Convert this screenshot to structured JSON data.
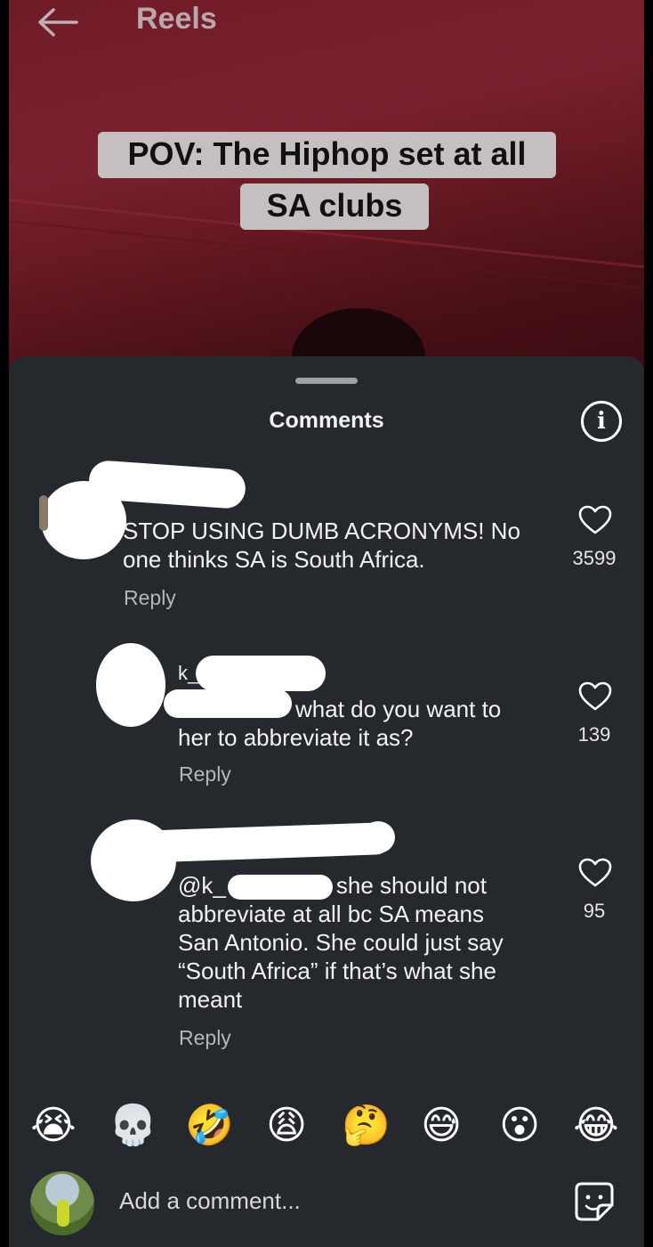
{
  "header": {
    "title": "Reels"
  },
  "video": {
    "caption_line1": "POV: The Hiphop set at all",
    "caption_line2": "SA clubs"
  },
  "sheet": {
    "title": "Comments"
  },
  "comments": [
    {
      "text": "STOP USING DUMB ACRONYMS! No one thinks SA is South Africa.",
      "line1": "STOP USING DUMB ACRONYMS! No",
      "line2": "one thinks SA is South Africa.",
      "likes": "3599",
      "reply_label": "Reply"
    },
    {
      "username_prefix": "k_",
      "line1": "what do you want to",
      "line2": "her to abbreviate it as?",
      "likes": "139",
      "reply_label": "Reply"
    },
    {
      "mention_prefix": "@k_",
      "line1": "she should not",
      "line2": "abbreviate at all bc SA means",
      "line3": "San Antonio. She could just say",
      "line4": "“South Africa” if that’s what she",
      "line5": "meant",
      "likes": "95",
      "reply_label": "Reply"
    }
  ],
  "emoji_bar": [
    "😭",
    "💀",
    "🤣",
    "😩",
    "🤔",
    "😅",
    "😮",
    "😂"
  ],
  "composer": {
    "placeholder": "Add a comment..."
  },
  "colors": {
    "sheet_bg": "#25282d",
    "video_bg": "#6f1b26"
  }
}
